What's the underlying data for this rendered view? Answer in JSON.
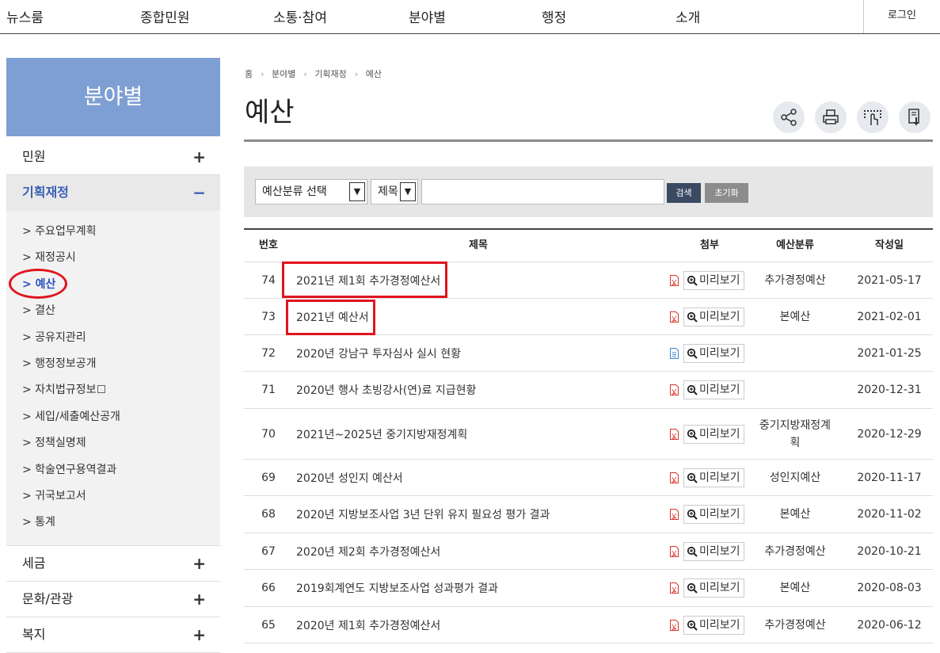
{
  "topnav": {
    "items": [
      "뉴스룸",
      "종합민원",
      "소통·참여",
      "분야별",
      "행정",
      "소개"
    ],
    "login": "로그인"
  },
  "sidebar": {
    "header": "분야별",
    "groups": [
      {
        "label": "민원",
        "sign": "+"
      },
      {
        "label": "기획재정",
        "sign": "−",
        "active": true
      },
      {
        "label": "세금",
        "sign": "+"
      },
      {
        "label": "문화/관광",
        "sign": "+"
      },
      {
        "label": "복지",
        "sign": "+"
      }
    ],
    "submenu": [
      "> 주요업무계획",
      "> 재정공시",
      "> 예산",
      "> 결산",
      "> 공유지관리",
      "> 행정정보공개",
      "> 자치법규정보",
      "> 세입/세출예산공개",
      "> 정책실명제",
      "> 학술연구용역결과",
      "> 귀국보고서",
      "> 통계"
    ]
  },
  "breadcrumb": [
    "홈",
    "분야별",
    "기획재정",
    "예산"
  ],
  "page_title": "예산",
  "tools": [
    "share-icon",
    "print-icon",
    "accessibility-icon",
    "download-icon"
  ],
  "search": {
    "category_select": "예산분류 선택",
    "field_select": "제목",
    "query": "",
    "search_button": "검색",
    "reset_button": "초기화"
  },
  "table": {
    "headers": {
      "num": "번호",
      "title": "제목",
      "attach": "첨부",
      "category": "예산분류",
      "date": "작성일"
    },
    "preview_label": "미리보기",
    "rows": [
      {
        "num": "74",
        "title": "2021년 제1회 추가경정예산서",
        "file": "pdf",
        "category": "추가경정예산",
        "date": "2021-05-17"
      },
      {
        "num": "73",
        "title": "2021년 예산서",
        "file": "pdf",
        "category": "본예산",
        "date": "2021-02-01"
      },
      {
        "num": "72",
        "title": "2020년 강남구 투자심사 실시 현황",
        "file": "doc",
        "category": "",
        "date": "2021-01-25"
      },
      {
        "num": "71",
        "title": "2020년 행사 초빙강사(연)료 지급현황",
        "file": "pdf",
        "category": "",
        "date": "2020-12-31"
      },
      {
        "num": "70",
        "title": "2021년~2025년 중기지방재정계획",
        "file": "pdf",
        "category": "중기지방재정계획",
        "date": "2020-12-29"
      },
      {
        "num": "69",
        "title": "2020년 성인지 예산서",
        "file": "pdf",
        "category": "성인지예산",
        "date": "2020-11-17"
      },
      {
        "num": "68",
        "title": "2020년 지방보조사업 3년 단위 유지 필요성 평가 결과",
        "file": "pdf",
        "category": "본예산",
        "date": "2020-11-02"
      },
      {
        "num": "67",
        "title": "2020년 제2회 추가경정예산서",
        "file": "pdf",
        "category": "추가경정예산",
        "date": "2020-10-21"
      },
      {
        "num": "66",
        "title": "2019회계연도 지방보조사업 성과평가 결과",
        "file": "pdf",
        "category": "본예산",
        "date": "2020-08-03"
      },
      {
        "num": "65",
        "title": "2020년 제1회 추가경정예산서",
        "file": "pdf",
        "category": "추가경정예산",
        "date": "2020-06-12"
      }
    ]
  },
  "colors": {
    "sidebar_header": "#7e9fd3",
    "active_text": "#3a5fb4",
    "annotation_red": "#e0141e",
    "search_button": "#3a4a63",
    "reset_button": "#8c8c8c",
    "pdf_icon": "#d9342b",
    "doc_icon": "#3a86c8"
  }
}
